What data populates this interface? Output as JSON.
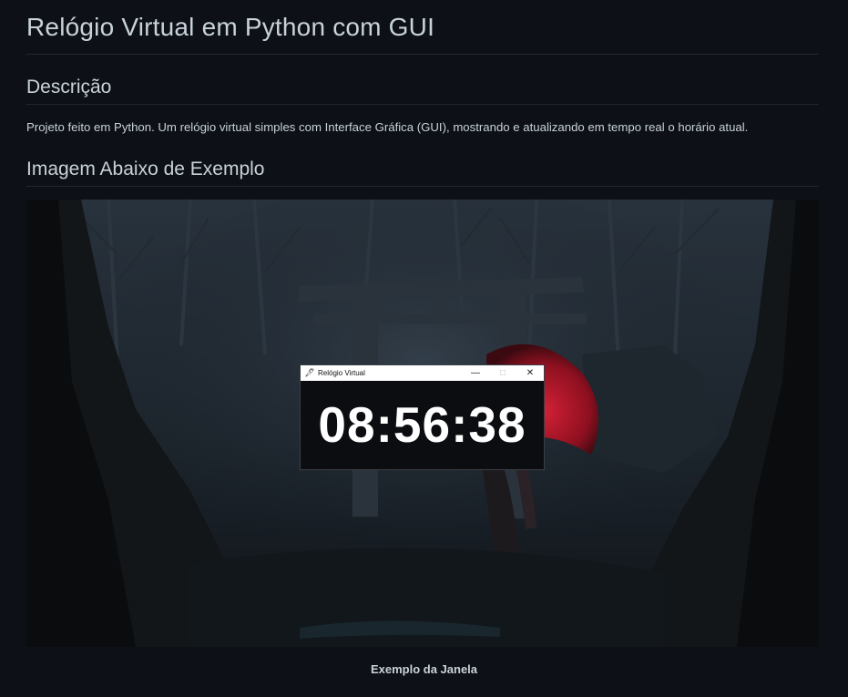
{
  "page": {
    "title": "Relógio Virtual em Python com GUI",
    "sections": [
      {
        "heading": "Descrição",
        "body": "Projeto feito em Python. Um relógio virtual simples com Interface Gráfica (GUI), mostrando e atualizando em tempo real o horário atual."
      },
      {
        "heading": "Imagem Abaixo de Exemplo"
      }
    ],
    "image_caption": "Exemplo da Janela"
  },
  "example_window": {
    "title": "Relógio Virtual",
    "icon": "feather-icon",
    "controls": [
      "minimize-icon",
      "maximize-icon",
      "close-icon"
    ],
    "time": "08:56:38"
  },
  "colors": {
    "background": "#0d1117",
    "text": "#c9d1d9",
    "divider": "#21262d",
    "clock_text": "#ffffff",
    "clock_bg": "#0b0d10",
    "umbrella": "#b01a2a"
  }
}
